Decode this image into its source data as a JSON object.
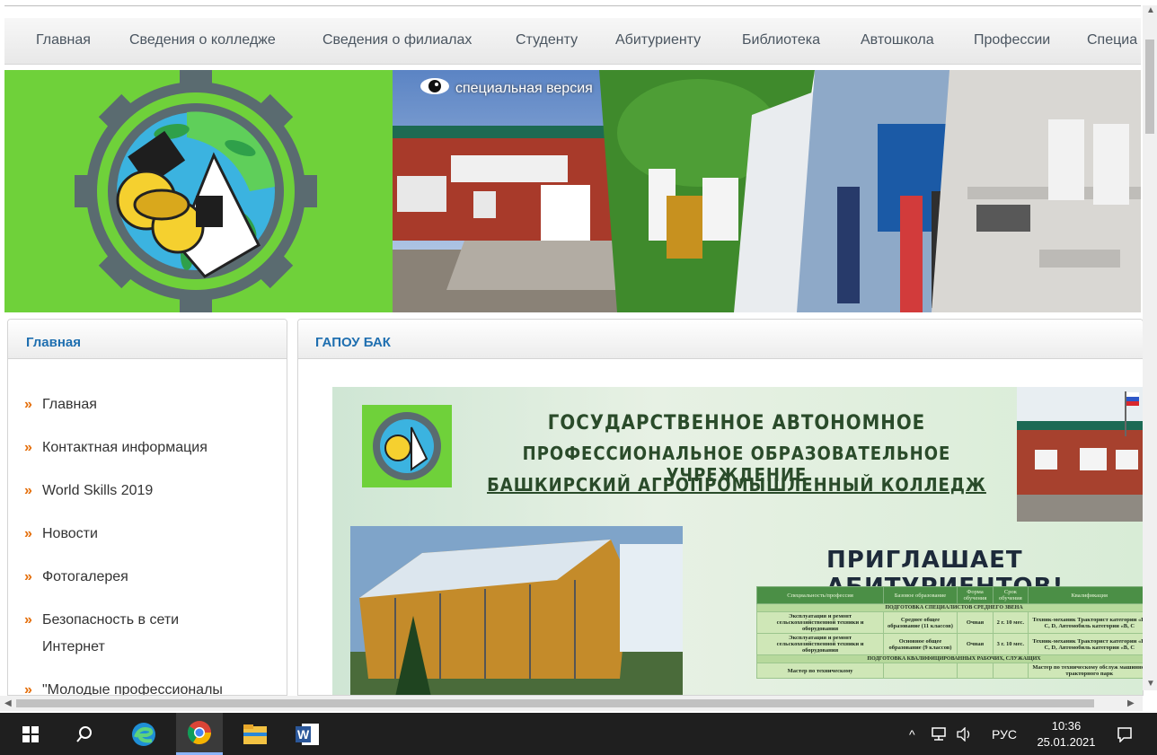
{
  "nav": {
    "items": [
      "Главная",
      "Сведения о колледже",
      "Сведения о филиалах",
      "Студенту",
      "Абитуриенту",
      "Библиотека",
      "Автошкола",
      "Профессии",
      "Специа"
    ]
  },
  "banner": {
    "special_version_label": "специальная версия"
  },
  "sidebar": {
    "title": "Главная",
    "items": [
      {
        "label": "Главная"
      },
      {
        "label": "Контактная информация"
      },
      {
        "label": "World Skills 2019"
      },
      {
        "label": "Новости"
      },
      {
        "label": "Фотогалерея"
      },
      {
        "label": "Безопасность в сети Интернет"
      },
      {
        "label": "\"Молодые профессионалы"
      }
    ],
    "bullet": "»"
  },
  "main": {
    "title": "ГАПОУ БАК",
    "poster": {
      "line1": "ГОСУДАРСТВЕННОЕ АВТОНОМНОЕ",
      "line2": "ПРОФЕССИОНАЛЬНОЕ ОБРАЗОВАТЕЛЬНОЕ УЧРЕЖДЕНИЕ",
      "line3": "БАШКИРСКИЙ АГРОПРОМЫШЛЕННЫЙ КОЛЛЕДЖ",
      "invite": "ПРИГЛАШАЕТ АБИТУРИЕНТОВ!",
      "table": {
        "headers": [
          "Специальность/профессия",
          "Базовое образование",
          "Форма обучения",
          "Срок обучения",
          "Квалификация"
        ],
        "group1": "ПОДГОТОВКА СПЕЦИАЛИСТОВ СРЕДНЕГО ЗВЕНА",
        "rows": [
          [
            "Эксплуатация и ремонт сельскохозяйственной техники и оборудования",
            "Среднее общее образование (11 классов)",
            "Очная",
            "2 г. 10 мес.",
            "Техник-механик Тракторист категории «B, C, D, Автомобиль категории «B, C"
          ],
          [
            "Эксплуатация и ремонт сельскохозяйственной техники и оборудования",
            "Основное общее образование (9 классов)",
            "Очная",
            "3 г. 10 мес.",
            "Техник-механик Тракторист категории «B, C, D, Автомобиль категории «B, C"
          ]
        ],
        "group2": "ПОДГОТОВКА КВАЛИФИЦИРОВАННЫХ РАБОЧИХ, СЛУЖАЩИХ",
        "row3": [
          "Мастер по техническому",
          "",
          "",
          "",
          "Мастер по техническому обслуж машинно-тракторного парк"
        ]
      }
    }
  },
  "taskbar": {
    "tray_lang": "РУС",
    "time": "10:36",
    "date": "25.01.2021"
  },
  "colors": {
    "accent_blue": "#1f6fb0",
    "bullet_orange": "#e46e0a",
    "logo_green": "#6fd13a"
  }
}
